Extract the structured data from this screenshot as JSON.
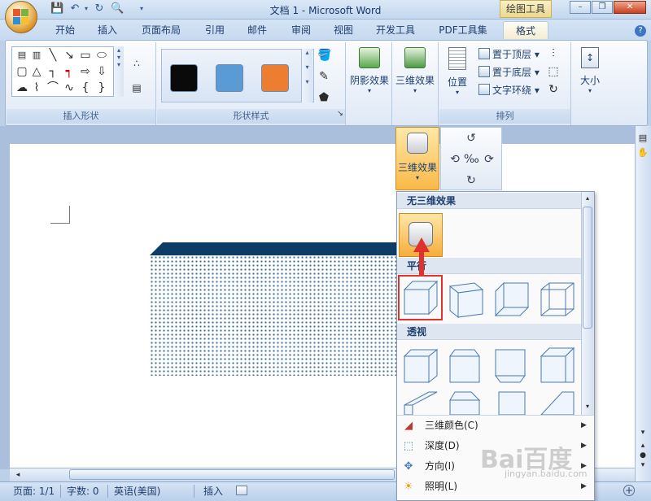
{
  "window": {
    "title": "文档 1 - Microsoft Word",
    "context_tab": "绘图工具"
  },
  "tabs": [
    "开始",
    "插入",
    "页面布局",
    "引用",
    "邮件",
    "审阅",
    "视图",
    "开发工具",
    "PDF工具集",
    "格式"
  ],
  "ribbon": {
    "insert_shapes_label": "插入形状",
    "shape_styles_label": "形状样式",
    "shadow_effects": "阴影效果",
    "three_d_effects": "三维效果",
    "position": "位置",
    "bring_front": "置于顶层",
    "send_back": "置于底层",
    "text_wrap": "文字环绕",
    "arrange_label": "排列",
    "size": "大小",
    "style_colors": [
      "#0a0a0a",
      "#5b9bd5",
      "#ed7d31"
    ]
  },
  "dropdown": {
    "button_label": "三维效果",
    "no_3d": "无三维效果",
    "parallel": "平行",
    "perspective": "透视",
    "menu": [
      {
        "label": "三维颜色(C)",
        "icon": "paint-bucket-icon"
      },
      {
        "label": "深度(D)",
        "icon": "depth-icon"
      },
      {
        "label": "方向(I)",
        "icon": "direction-icon"
      },
      {
        "label": "照明(L)",
        "icon": "lighting-icon"
      }
    ]
  },
  "status": {
    "page": "页面: 1/1",
    "words": "字数: 0",
    "language": "英语(美国)",
    "mode": "插入"
  },
  "watermark": {
    "main": "Bai百度",
    "sub": "jingyan.baidu.com"
  }
}
